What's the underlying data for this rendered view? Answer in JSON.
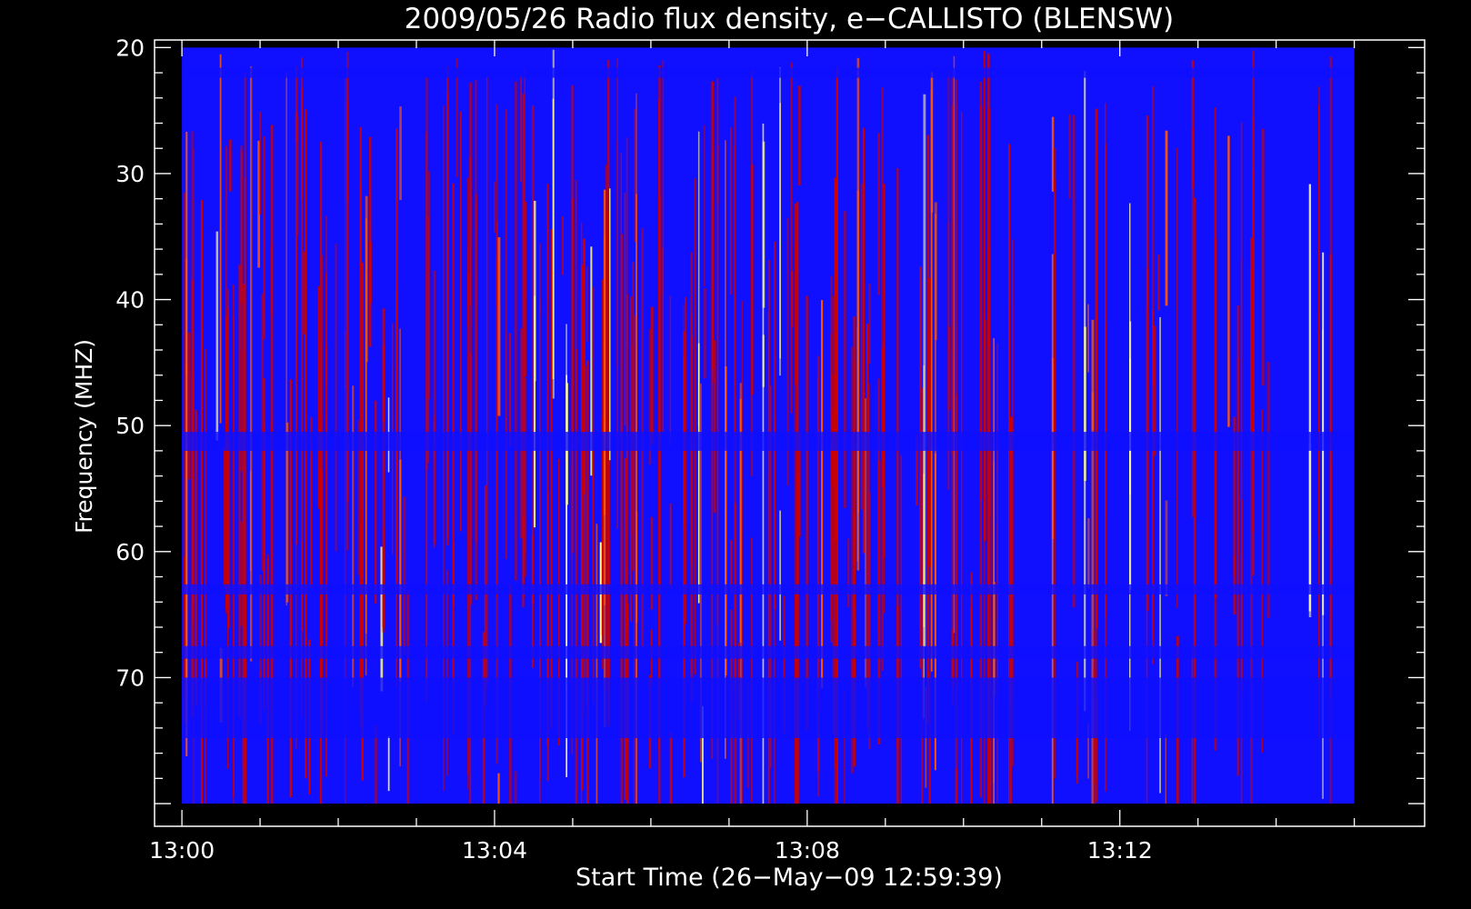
{
  "chart_data": {
    "type": "heatmap",
    "title": "2009/05/26  Radio flux density, e−CALLISTO (BLENSW)",
    "xlabel": "Start Time (26−May−09 12:59:39)",
    "ylabel": "Frequency (MHZ)",
    "x_unit": "minutes",
    "x_axis_range": [
      "12:59:39",
      "13:15:54"
    ],
    "x_data_range": [
      "13:00:00",
      "13:15:00"
    ],
    "y_axis_range": [
      19.4,
      81.8
    ],
    "y_data_range": [
      20,
      80
    ],
    "y_inverted": true,
    "xticks": [
      {
        "value": "13:00",
        "label": "13:00"
      },
      {
        "value": "13:04",
        "label": "13:04"
      },
      {
        "value": "13:08",
        "label": "13:08"
      },
      {
        "value": "13:12",
        "label": "13:12"
      }
    ],
    "yticks": [
      {
        "value": 20,
        "label": "20"
      },
      {
        "value": 30,
        "label": "30"
      },
      {
        "value": 40,
        "label": "40"
      },
      {
        "value": 50,
        "label": "50"
      },
      {
        "value": 60,
        "label": "60"
      },
      {
        "value": 70,
        "label": "70"
      }
    ],
    "colormap": [
      "#000000",
      "#1010ff",
      "#cc0000",
      "#ff5500",
      "#ffff88"
    ],
    "background_color": "#000000",
    "axis_color": "#ffffff",
    "quiet_bands_mhz": [
      [
        21.6,
        22.4
      ],
      [
        50.5,
        52.0
      ],
      [
        62.6,
        63.4
      ],
      [
        67.5,
        68.5
      ],
      [
        70.0,
        74.8
      ]
    ],
    "grid": false
  }
}
